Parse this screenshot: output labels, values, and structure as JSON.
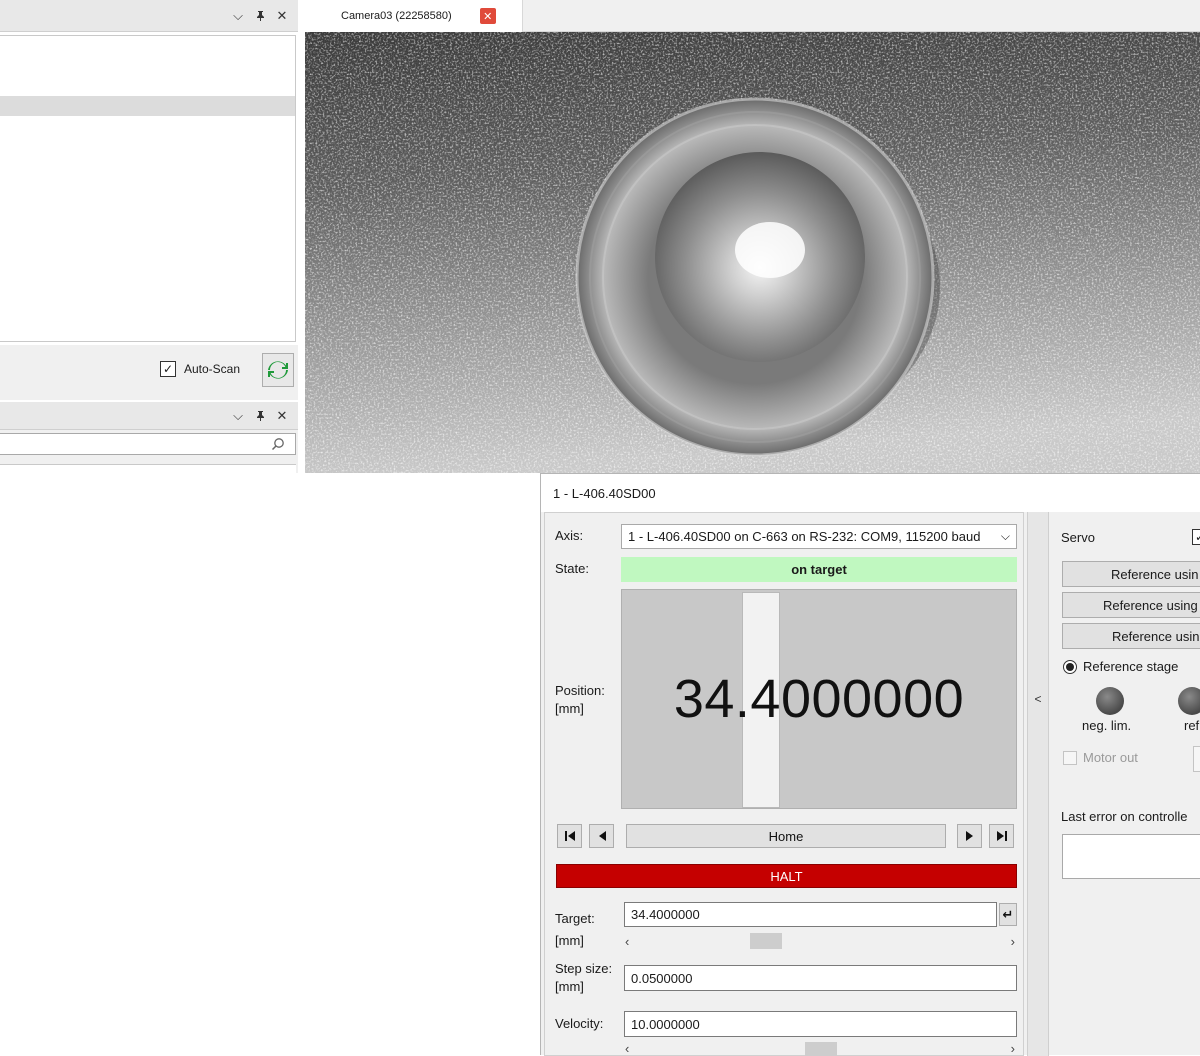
{
  "device_panel": {
    "auto_scan_label": "Auto-Scan",
    "auto_scan_checked": true
  },
  "camera": {
    "tab_title": "Camera03 (22258580)"
  },
  "axis_window": {
    "title": "1 - L-406.40SD00",
    "axis_label": "Axis:",
    "axis_value": "1 - L-406.40SD00 on C-663 on RS-232: COM9, 115200 baud",
    "state_label": "State:",
    "state_value": "on target",
    "position_label": "Position:",
    "position_unit": "[mm]",
    "position_value": "34.4000000",
    "home_label": "Home",
    "halt_label": "HALT",
    "target_label": "Target:",
    "target_unit": "[mm]",
    "target_value": "34.4000000",
    "step_label": "Step size:",
    "step_unit": "[mm]",
    "step_value": "0.0500000",
    "velocity_label": "Velocity:",
    "velocity_value": "10.0000000",
    "collapse_arrow": "<",
    "servo_label": "Servo",
    "ref_btn_1": "Reference usin",
    "ref_btn_2": "Reference using",
    "ref_btn_3": "Reference usin",
    "reference_stage_label": "Reference stage",
    "neg_lim_label": "neg. lim.",
    "ref_lamp_label": "ref",
    "motor_out_label": "Motor out",
    "last_error_label": "Last error on controlle"
  },
  "colors": {
    "state_ok": "#c0f8c0",
    "halt": "#c50000",
    "refresh_icon": "#1f9a3a",
    "tab_close": "#e04a3a"
  }
}
